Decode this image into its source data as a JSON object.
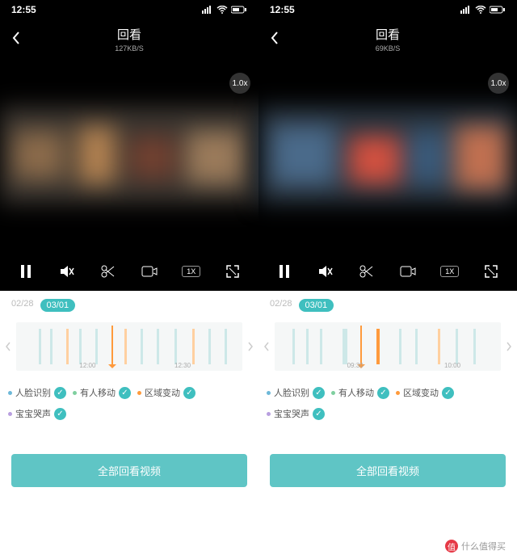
{
  "status": {
    "time": "12:55"
  },
  "panes": [
    {
      "title": "回看",
      "speed": "127KB/S",
      "speedBadge": "1.0x",
      "dates": {
        "inactive": "02/28",
        "active": "03/01"
      },
      "timeline": {
        "t1": "12:00",
        "t2": "12:30"
      },
      "button": "全部回看视频"
    },
    {
      "title": "回看",
      "speed": "69KB/S",
      "speedBadge": "1.0x",
      "dates": {
        "inactive": "02/28",
        "active": "03/01"
      },
      "timeline": {
        "t1": "09:30",
        "t2": "10:00"
      },
      "button": "全部回看视频"
    }
  ],
  "filters": [
    {
      "dot": "#6db8d8",
      "label": "人脸识别"
    },
    {
      "dot": "#7fcf9f",
      "label": "有人移动"
    },
    {
      "dot": "#ff9a3c",
      "label": "区域变动"
    },
    {
      "dot": "#b89fdf",
      "label": "宝宝哭声"
    }
  ],
  "speedBox": "1X",
  "watermark": "什么值得买"
}
